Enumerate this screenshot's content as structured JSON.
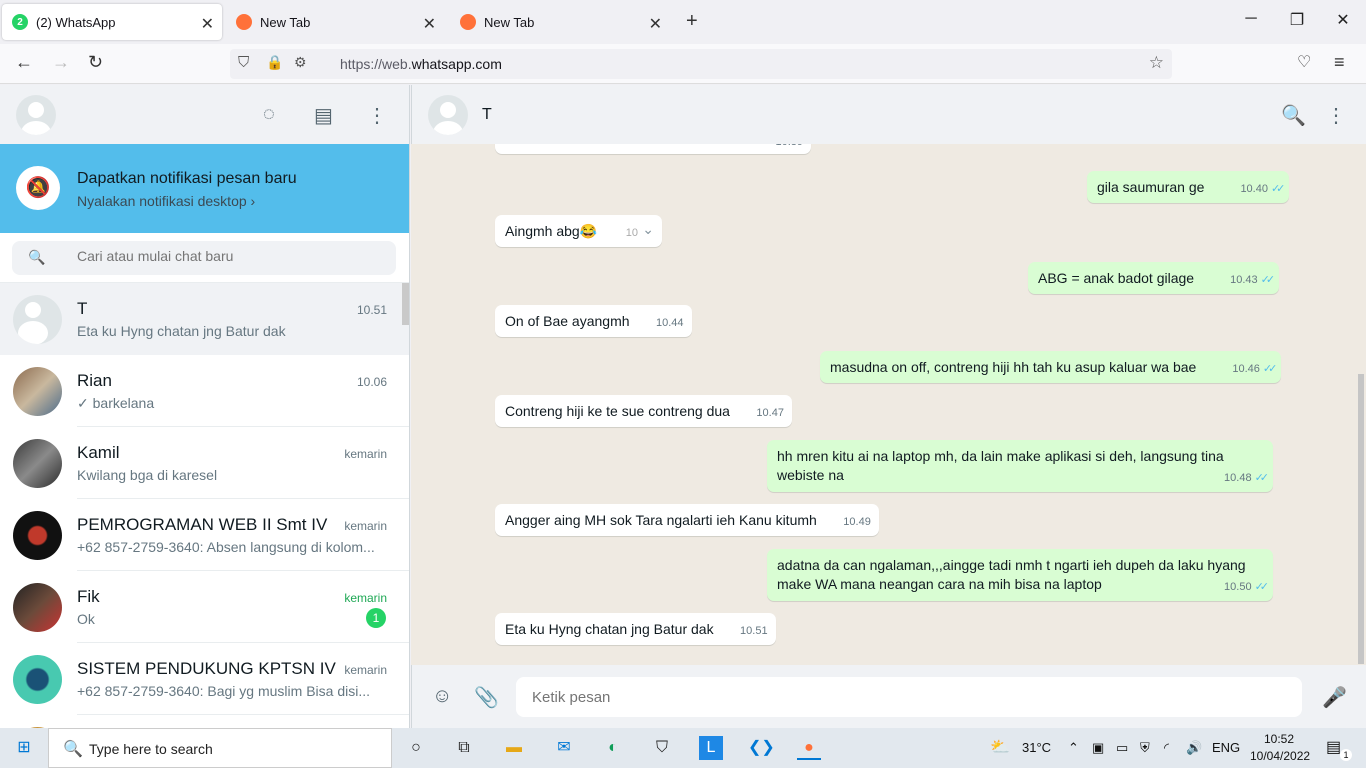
{
  "browser": {
    "tabs": [
      {
        "title": "(2) WhatsApp",
        "favicon_text": "2"
      },
      {
        "title": "New Tab"
      },
      {
        "title": "New Tab"
      }
    ],
    "url_prefix": "https://web.",
    "url_domain": "whatsapp.com"
  },
  "left_panel": {
    "notification": {
      "title": "Dapatkan notifikasi pesan baru",
      "subtitle": "Nyalakan notifikasi desktop ›"
    },
    "search_placeholder": "Cari atau mulai chat baru",
    "chats": [
      {
        "name": "T",
        "message": "Eta ku Hyng chatan jng Batur dak",
        "time": "10.51"
      },
      {
        "name": "Rian",
        "message": "✓ barkelana",
        "time": "10.06"
      },
      {
        "name": "Kamil",
        "message": "Kwilang bga di karesel",
        "time": "kemarin"
      },
      {
        "name": "PEMROGRAMAN WEB II Smt IV",
        "message": "+62 857-2759-3640: Absen langsung di kolom...",
        "time": "kemarin"
      },
      {
        "name": "Fik",
        "message": "Ok",
        "time": "kemarin",
        "unread": "1"
      },
      {
        "name": "SISTEM PENDUKUNG KPTSN IV",
        "message": "+62 857-2759-3640: Bagi yg muslim Bisa disi...",
        "time": "kemarin"
      }
    ]
  },
  "conversation": {
    "contact_name": "T",
    "messages": [
      {
        "dir": "out",
        "text": "gila saumuran ge",
        "time": "10.40"
      },
      {
        "dir": "in",
        "text": "Aingmh abg😂",
        "time": "10"
      },
      {
        "dir": "out",
        "text": "ABG = anak badot gilage",
        "time": "10.43"
      },
      {
        "dir": "in",
        "text": "On of Bae ayangmh",
        "time": "10.44"
      },
      {
        "dir": "out",
        "text": "masudna on off, contreng hiji hh tah ku asup kaluar wa bae",
        "time": "10.46"
      },
      {
        "dir": "in",
        "text": "Contreng hiji ke te sue contreng dua",
        "time": "10.47"
      },
      {
        "dir": "out",
        "text": "hh mren kitu ai na laptop mh, da lain make aplikasi si deh, langsung tina webiste na",
        "time": "10.48"
      },
      {
        "dir": "in",
        "text": "Angger aing MH sok Tara ngalarti ieh Kanu kitumh",
        "time": "10.49"
      },
      {
        "dir": "out",
        "text": "adatna da can ngalaman,,,aingge tadi nmh t ngarti ieh dupeh da laku hyang make WA mana neangan cara na mih bisa na laptop",
        "time": "10.50"
      },
      {
        "dir": "in",
        "text": "Eta ku Hyng chatan jng Batur dak",
        "time": "10.51"
      }
    ],
    "top_partial_time": "10.39",
    "composer_placeholder": "Ketik pesan"
  },
  "taskbar": {
    "search_text": "Type here to search",
    "weather": "31°C",
    "language": "ENG",
    "time": "10:52",
    "date": "10/04/2022",
    "notification_count": "1"
  },
  "colors": {
    "accent_blue": "#53bdeb",
    "outgoing_bubble": "#d9fdd3",
    "unread_green": "#25d366",
    "chat_bg": "#efeae2"
  }
}
